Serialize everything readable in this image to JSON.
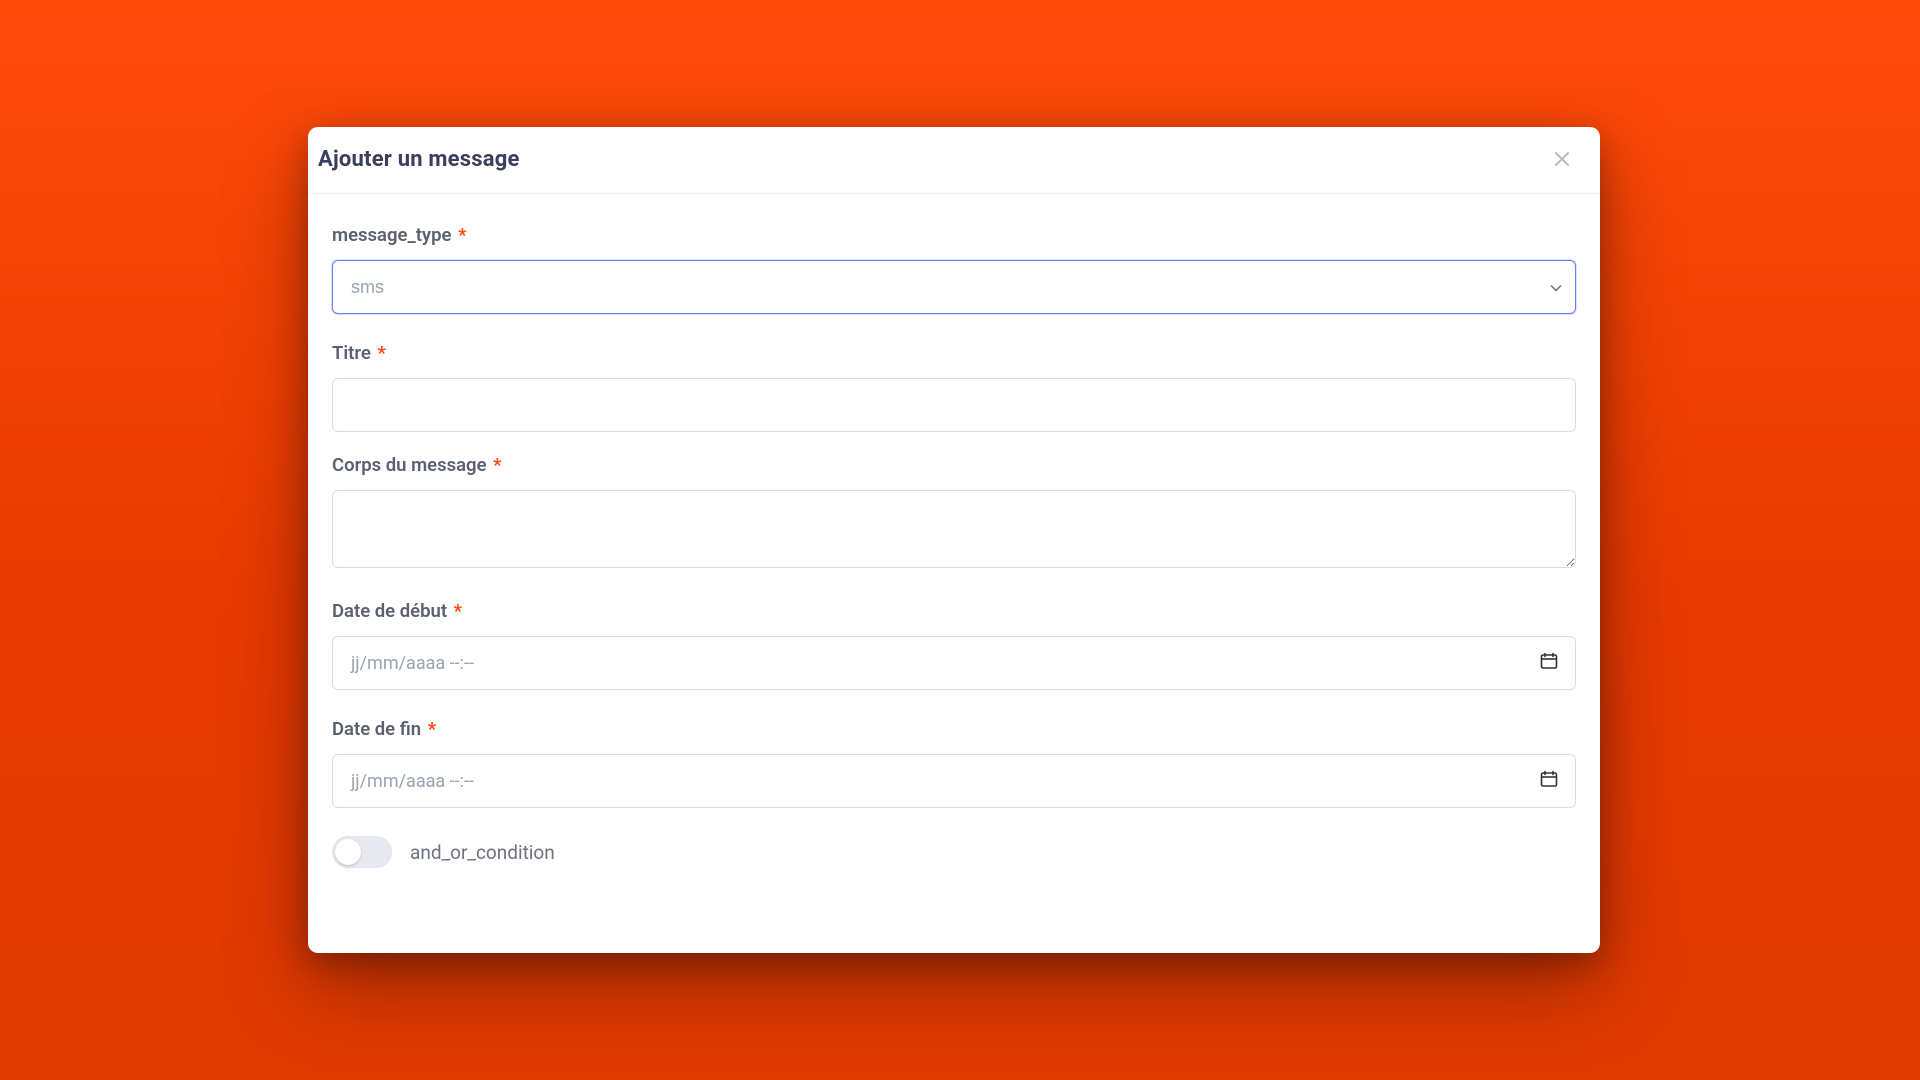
{
  "modal": {
    "title": "Ajouter un message",
    "fields": {
      "message_type": {
        "label": "message_type",
        "required_mark": "*",
        "selected": "sms",
        "options": [
          "sms"
        ]
      },
      "titre": {
        "label": "Titre",
        "required_mark": "*",
        "value": ""
      },
      "corps": {
        "label": "Corps du message",
        "required_mark": "*",
        "value": ""
      },
      "date_debut": {
        "label": "Date de début",
        "required_mark": "*",
        "placeholder": "jj/mm/aaaa --:--"
      },
      "date_fin": {
        "label": "Date de fin",
        "required_mark": "*",
        "placeholder": "jj/mm/aaaa --:--"
      },
      "and_or_condition": {
        "label": "and_or_condition",
        "checked": false
      }
    }
  }
}
